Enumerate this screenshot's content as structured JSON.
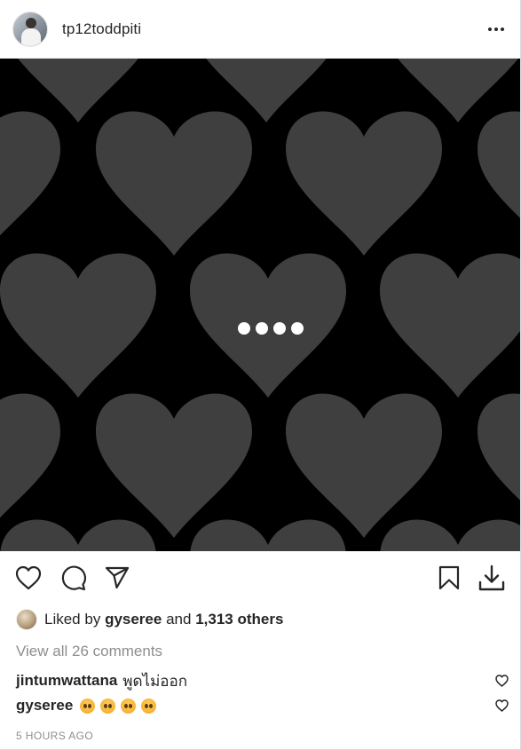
{
  "header": {
    "username": "tp12toddpiti",
    "avatar_icon": "profile-photo",
    "more_icon": "more-horizontal-icon"
  },
  "media": {
    "background_color": "#000000",
    "heart_color": "#3f3f3f",
    "carousel_indicator_count": 4
  },
  "actions": {
    "like_icon": "heart-outline-icon",
    "comment_icon": "comment-bubble-icon",
    "share_icon": "paper-plane-icon",
    "save_icon": "bookmark-icon",
    "download_icon": "download-icon"
  },
  "likes": {
    "prefix": "Liked by",
    "user": "gyseree",
    "conjunction": "and",
    "others": "1,313 others"
  },
  "comments": {
    "view_all": "View all 26 comments",
    "items": [
      {
        "user": "jintumwattana",
        "text": "พูดไม่ออก",
        "emoji_count": 0
      },
      {
        "user": "gyseree",
        "text": "",
        "emoji_count": 4
      }
    ]
  },
  "timestamp": "5 HOURS AGO"
}
